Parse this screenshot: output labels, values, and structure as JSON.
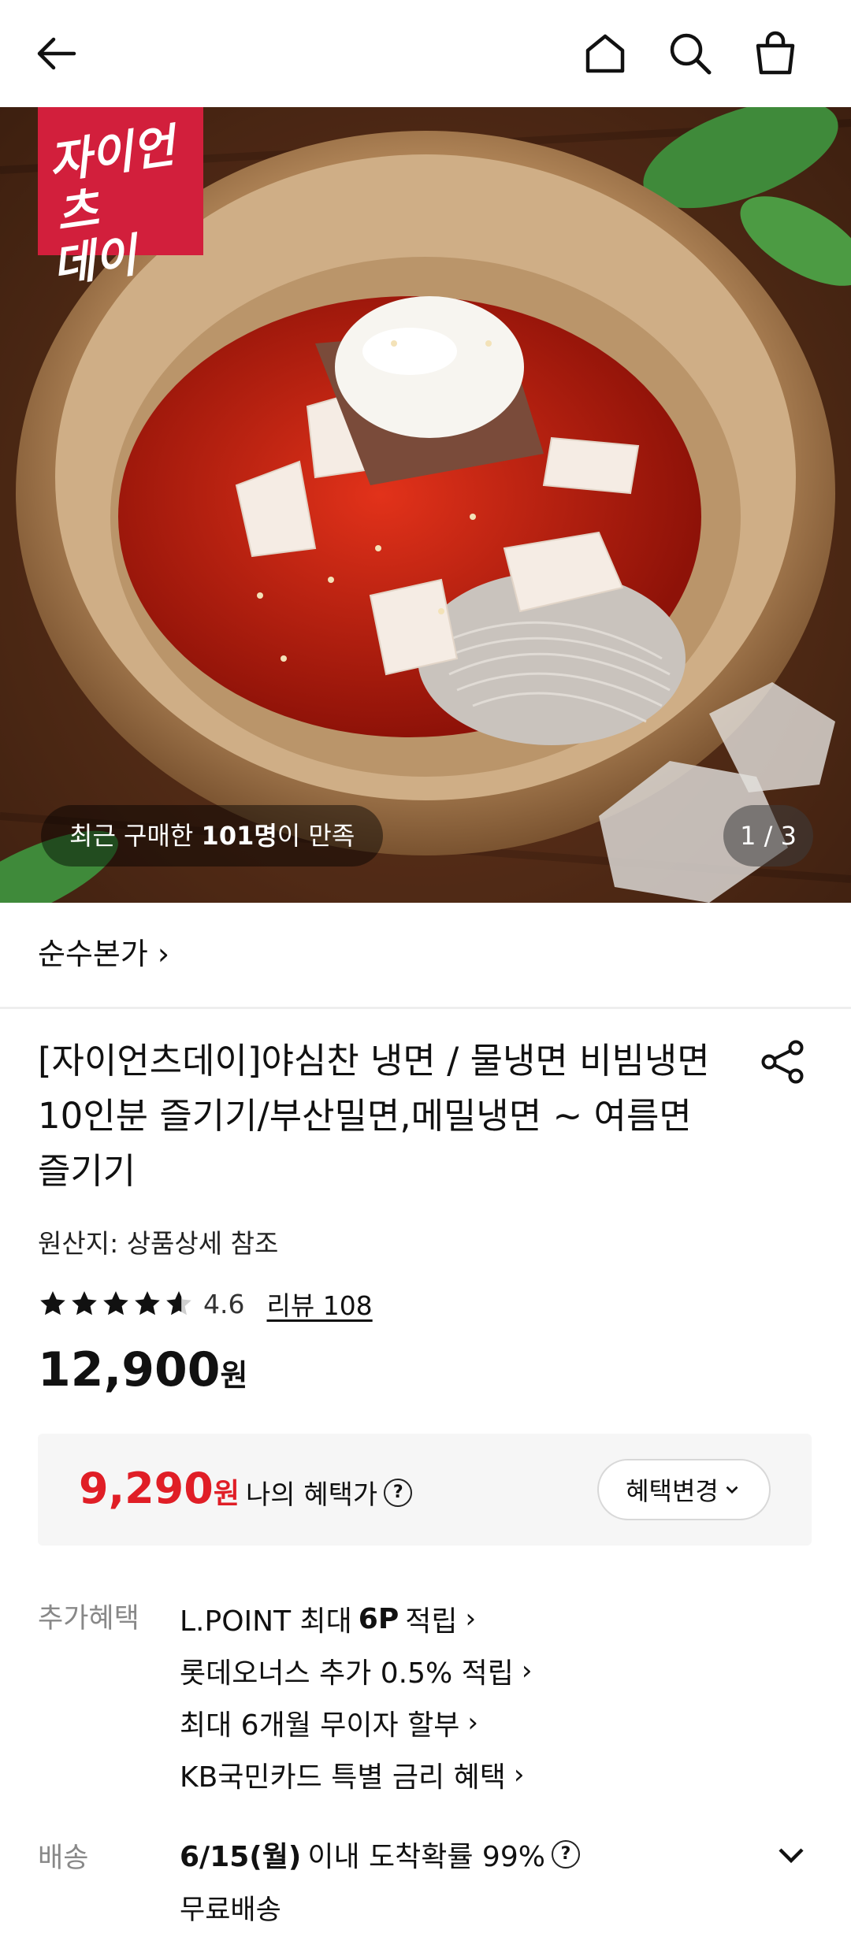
{
  "topbar": {
    "icons": [
      "back-arrow-icon",
      "home-icon",
      "search-icon",
      "shopping-bag-icon"
    ]
  },
  "hero": {
    "brand_badge_line1": "자이언츠",
    "brand_badge_line2": "데이",
    "buyers_prefix": "최근 구매한 ",
    "buyers_count": "101명",
    "buyers_suffix": "이 만족",
    "page_indicator": "1 / 3"
  },
  "seller": {
    "name": "순수본가 ›"
  },
  "product": {
    "title": "[자이언츠데이]야심찬 냉면 / 물냉면 비빔냉면 10인분 즐기기/부산밀면,메밀냉면 ~ 여름면 즐기기",
    "origin": "원산지: 상품상세 참조",
    "rating_value": 4.6,
    "rating_text": "4.6",
    "reviews": "리뷰 108",
    "price": "12,900",
    "price_unit": "원"
  },
  "benefit": {
    "price": "9,290",
    "price_unit": "원",
    "label": "나의 혜택가",
    "help": "?",
    "change_button": "혜택변경"
  },
  "extra_benefits": {
    "label": "추가혜택",
    "items": [
      {
        "pre": "L.POINT 최대",
        "bold": "6P",
        "post": "적립"
      },
      {
        "pre": "롯데오너스 추가 0.5% 적립",
        "bold": "",
        "post": ""
      },
      {
        "pre": "최대 6개월 무이자 할부",
        "bold": "",
        "post": ""
      },
      {
        "pre": "KB국민카드 특별 금리 혜택",
        "bold": "",
        "post": ""
      }
    ]
  },
  "shipping": {
    "label": "배송",
    "date": "6/15(월)",
    "desc": "이내 도착확률 99%",
    "help": "?",
    "free": "무료배송"
  },
  "colors": {
    "accent_red": "#e01e26",
    "badge_red": "#d21f3c",
    "muted": "#888888"
  }
}
